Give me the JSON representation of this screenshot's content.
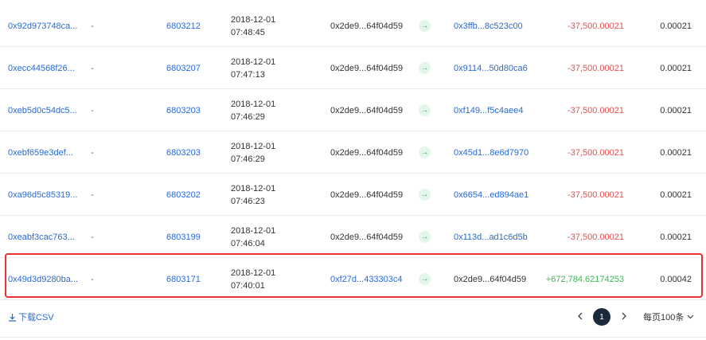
{
  "rows": [
    {
      "hash": "0x92d973748ca...",
      "method": "-",
      "block": "6803212",
      "date": "2018-12-01",
      "time": "07:48:45",
      "from": "0x2de9...64f04d59",
      "to": "0x3ffb...8c523c00",
      "amount": "-37,500.00021",
      "fee": "0.00021",
      "from_link": false,
      "to_link": true,
      "amount_sign": "negative"
    },
    {
      "hash": "0xecc44568f26...",
      "method": "-",
      "block": "6803207",
      "date": "2018-12-01",
      "time": "07:47:13",
      "from": "0x2de9...64f04d59",
      "to": "0x9114...50d80ca6",
      "amount": "-37,500.00021",
      "fee": "0.00021",
      "from_link": false,
      "to_link": true,
      "amount_sign": "negative"
    },
    {
      "hash": "0xeb5d0c54dc5...",
      "method": "-",
      "block": "6803203",
      "date": "2018-12-01",
      "time": "07:46:29",
      "from": "0x2de9...64f04d59",
      "to": "0xf149...f5c4aee4",
      "amount": "-37,500.00021",
      "fee": "0.00021",
      "from_link": false,
      "to_link": true,
      "amount_sign": "negative"
    },
    {
      "hash": "0xebf659e3def...",
      "method": "-",
      "block": "6803203",
      "date": "2018-12-01",
      "time": "07:46:29",
      "from": "0x2de9...64f04d59",
      "to": "0x45d1...8e6d7970",
      "amount": "-37,500.00021",
      "fee": "0.00021",
      "from_link": false,
      "to_link": true,
      "amount_sign": "negative"
    },
    {
      "hash": "0xa96d5c85319...",
      "method": "-",
      "block": "6803202",
      "date": "2018-12-01",
      "time": "07:46:23",
      "from": "0x2de9...64f04d59",
      "to": "0x6654...ed894ae1",
      "amount": "-37,500.00021",
      "fee": "0.00021",
      "from_link": false,
      "to_link": true,
      "amount_sign": "negative"
    },
    {
      "hash": "0xeabf3cac763...",
      "method": "-",
      "block": "6803199",
      "date": "2018-12-01",
      "time": "07:46:04",
      "from": "0x2de9...64f04d59",
      "to": "0x113d...ad1c6d5b",
      "amount": "-37,500.00021",
      "fee": "0.00021",
      "from_link": false,
      "to_link": true,
      "amount_sign": "negative"
    },
    {
      "hash": "0x49d3d9280ba...",
      "method": "-",
      "block": "6803171",
      "date": "2018-12-01",
      "time": "07:40:01",
      "from": "0xf27d...433303c4",
      "to": "0x2de9...64f04d59",
      "amount": "+672,784.62174253",
      "fee": "0.00042",
      "from_link": true,
      "to_link": false,
      "amount_sign": "positive"
    }
  ],
  "highlighted_row_index": 6,
  "footer": {
    "download_label": "下载CSV",
    "current_page": "1",
    "page_size_label": "每页100条"
  },
  "icons": {
    "transfer": "arrow-right-icon",
    "download": "download-icon",
    "prev": "chevron-left-icon",
    "next": "chevron-right-icon",
    "dropdown": "chevron-down-icon"
  },
  "colors": {
    "link": "#2a6ad4",
    "negative": "#e05252",
    "positive": "#3fb55a",
    "highlight_border": "#e8302e",
    "active_page": "#1b2a3a"
  }
}
